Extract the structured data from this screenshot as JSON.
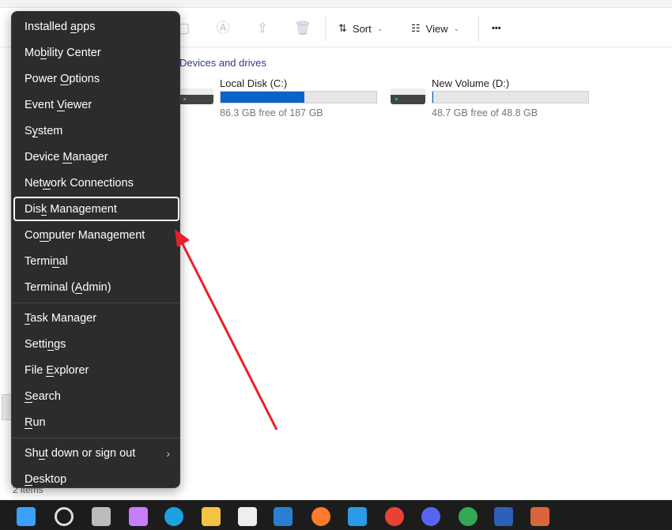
{
  "toolbar": {
    "sort_label": "Sort",
    "view_label": "View",
    "more_label": "•••"
  },
  "content": {
    "section_title": "Devices and drives",
    "drives": [
      {
        "name": "Local Disk (C:)",
        "free_text": "86.3 GB free of 187 GB",
        "used_fraction": 0.54,
        "icon": "windows-drive-icon"
      },
      {
        "name": "New Volume (D:)",
        "free_text": "48.7 GB free of 48.8 GB",
        "used_fraction": 0.002,
        "icon": "drive-icon"
      }
    ],
    "status": "2 items"
  },
  "menu": {
    "selected": "Disk Management",
    "groups": [
      [
        {
          "label": "Installed apps",
          "key": 10
        },
        {
          "label": "Mobility Center",
          "key": 2
        },
        {
          "label": "Power Options",
          "key": 6
        },
        {
          "label": "Event Viewer",
          "key": 6
        },
        {
          "label": "System",
          "key": 1
        },
        {
          "label": "Device Manager",
          "key": 7
        },
        {
          "label": "Network Connections",
          "key": 3
        },
        {
          "label": "Disk Management",
          "key": 3
        },
        {
          "label": "Computer Management",
          "key": 2
        },
        {
          "label": "Terminal",
          "key": 5
        },
        {
          "label": "Terminal (Admin)",
          "key": 10
        }
      ],
      [
        {
          "label": "Task Manager",
          "key": 0
        },
        {
          "label": "Settings",
          "key": 5
        },
        {
          "label": "File Explorer",
          "key": 5
        },
        {
          "label": "Search",
          "key": 0
        },
        {
          "label": "Run",
          "key": 0
        }
      ],
      [
        {
          "label": "Shut down or sign out",
          "key": 2,
          "submenu": true
        },
        {
          "label": "Desktop",
          "key": 0
        }
      ]
    ]
  },
  "taskbar": {
    "apps": [
      "start",
      "search",
      "task-view",
      "copilot",
      "edge",
      "file-explorer",
      "store",
      "outlook",
      "firefox",
      "vscode",
      "chrome-profile-m",
      "discord",
      "chrome-profile-m2",
      "word",
      "app"
    ]
  },
  "colors": {
    "accent": "#0a63c9",
    "annotation_arrow": "#e8202a",
    "menu_bg": "#2c2c2c"
  }
}
